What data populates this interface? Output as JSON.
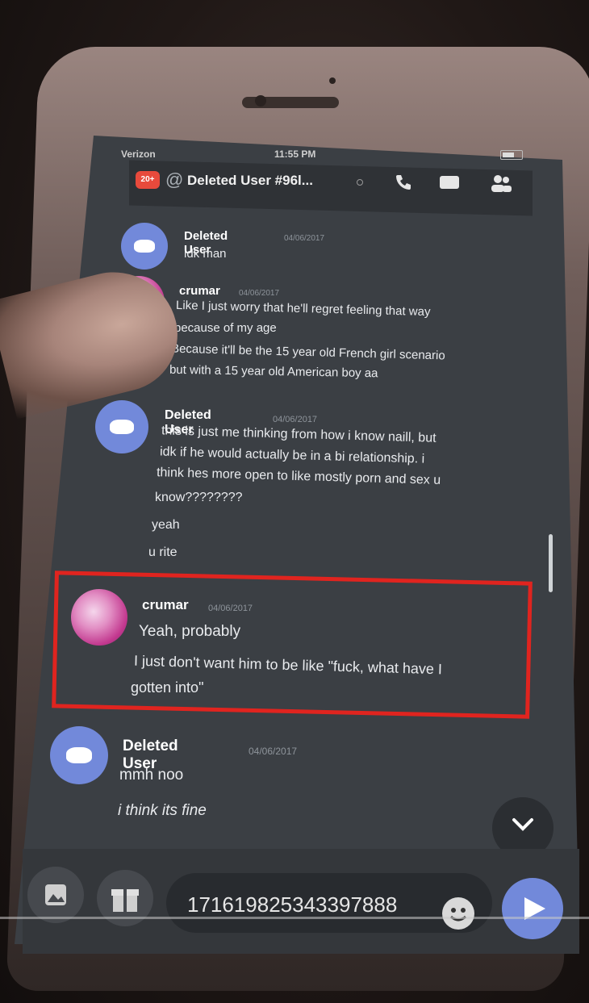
{
  "status_bar": {
    "carrier": "Verizon",
    "time": "11:55 PM"
  },
  "header": {
    "badge": "20+",
    "at_symbol": "@",
    "title": "Deleted User #96l...",
    "icons": [
      "call-icon",
      "video-icon",
      "members-icon"
    ]
  },
  "messages": [
    {
      "author": "Deleted User",
      "timestamp": "04/06/2017",
      "avatar": "discord-default",
      "lines": [
        "idk man"
      ]
    },
    {
      "author": "crumar",
      "timestamp": "04/06/2017",
      "avatar": "anime-avatar",
      "lines": [
        "Like I just worry that he'll regret feeling that way",
        "because of my age",
        "Because it'll be the 15 year old French girl scenario",
        "but with a 15 year old American boy aa"
      ]
    },
    {
      "author": "Deleted User",
      "timestamp": "04/06/2017",
      "avatar": "discord-default",
      "lines": [
        "this is just me thinking from how i know naill, but",
        "idk if he would actually be in a bi relationship. i",
        "think hes more open to like mostly porn and sex u",
        "know????????",
        "yeah",
        "u rite"
      ]
    },
    {
      "author": "crumar",
      "timestamp": "04/06/2017",
      "avatar": "anime-avatar",
      "lines": [
        "Yeah, probably",
        "I just don't want him to be like \"fuck, what have I",
        "gotten into\""
      ]
    },
    {
      "author": "Deleted User",
      "timestamp": "04/06/2017",
      "avatar": "discord-default",
      "lines": [
        "mmh noo",
        "i think its fine"
      ]
    }
  ],
  "composer": {
    "input_value": "171619825343397888",
    "icons": [
      "image-icon",
      "gift-icon",
      "emoji-icon",
      "send-icon"
    ]
  },
  "colors": {
    "highlight": "#e0241f",
    "accent": "#7289da",
    "background": "#3b3f44"
  }
}
